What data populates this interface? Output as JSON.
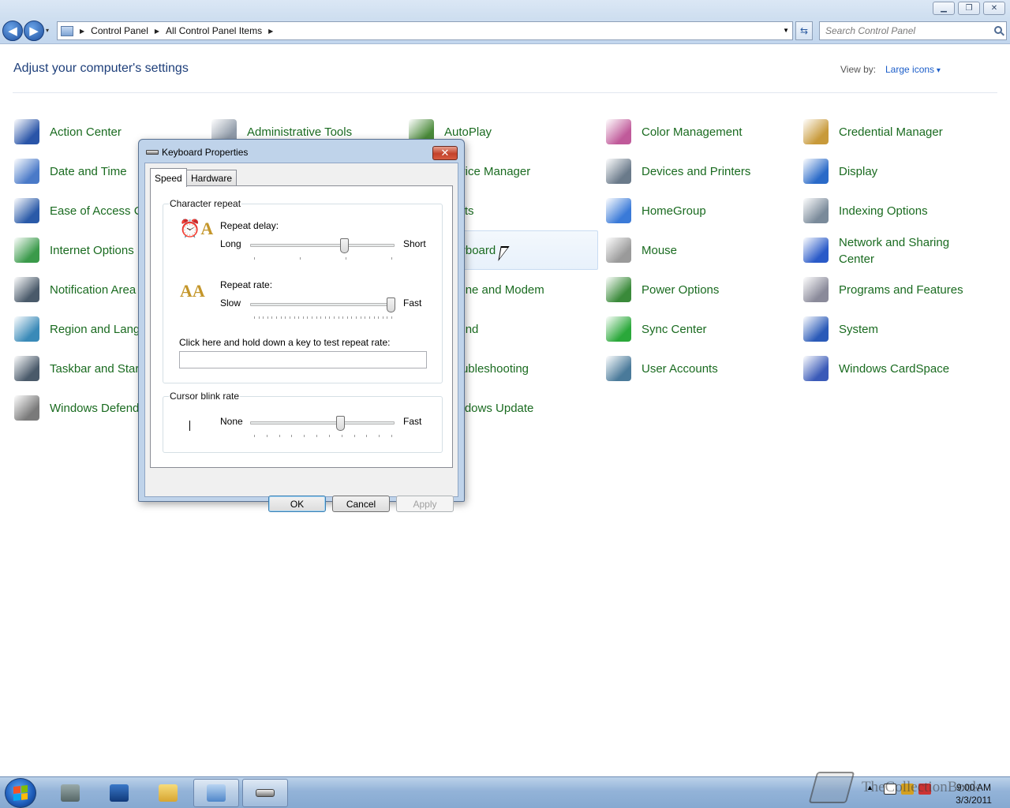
{
  "window": {
    "minimize_glyph": "▁",
    "restore_glyph": "❐",
    "close_glyph": "✕"
  },
  "nav": {
    "back_glyph": "◀",
    "forward_glyph": "▶",
    "dropdown_glyph": "▾",
    "breadcrumbs": [
      "Control Panel",
      "All Control Panel Items"
    ],
    "refresh_glyph": "⇆",
    "search_placeholder": "Search Control Panel"
  },
  "header": {
    "title": "Adjust your computer's settings",
    "view_by_label": "View by:",
    "view_by_value": "Large icons"
  },
  "items": [
    {
      "label": "Action Center",
      "icon": "flag-icon",
      "color": "#2a55a8"
    },
    {
      "label": "Administrative Tools",
      "icon": "gears-icon",
      "color": "#8f9aa8"
    },
    {
      "label": "AutoPlay",
      "icon": "autoplay-icon",
      "color": "#4a8a3a"
    },
    {
      "label": "Color Management",
      "icon": "color-management-icon",
      "color": "#c05a9a"
    },
    {
      "label": "Credential Manager",
      "icon": "vault-icon",
      "color": "#c89a3a"
    },
    {
      "label": "Date and Time",
      "icon": "calendar-clock-icon",
      "color": "#4a7ac8"
    },
    {
      "label": "Device Manager",
      "icon": "device-manager-icon",
      "color": "#6a7a8a"
    },
    {
      "label": "Devices and Printers",
      "icon": "printer-icon",
      "color": "#6a7a8a"
    },
    {
      "label": "Display",
      "icon": "monitor-icon",
      "color": "#2a6ac8"
    },
    {
      "label": "Ease of Access Center",
      "icon": "ease-of-access-icon",
      "color": "#2a5aa8"
    },
    {
      "label": "Fonts",
      "icon": "fonts-icon",
      "color": "#c8a43a"
    },
    {
      "label": "HomeGroup",
      "icon": "homegroup-icon",
      "color": "#3a7ad8"
    },
    {
      "label": "Indexing Options",
      "icon": "indexing-icon",
      "color": "#7a8a9a"
    },
    {
      "label": "Internet Options",
      "icon": "globe-icon",
      "color": "#3a9a4a"
    },
    {
      "label": "Keyboard",
      "icon": "keyboard-icon",
      "color": "#6a6a6a"
    },
    {
      "label": "Mouse",
      "icon": "mouse-icon",
      "color": "#9a9a9a"
    },
    {
      "label": "Network and Sharing Center",
      "icon": "network-icon",
      "color": "#2a5ac8"
    },
    {
      "label": "Notification Area Icons",
      "icon": "notification-icon",
      "color": "#4a5a6a"
    },
    {
      "label": "Phone and Modem",
      "icon": "phone-icon",
      "color": "#6a6a7a"
    },
    {
      "label": "Power Options",
      "icon": "battery-icon",
      "color": "#3a8a3a"
    },
    {
      "label": "Programs and Features",
      "icon": "programs-icon",
      "color": "#8a8a9a"
    },
    {
      "label": "Region and Language",
      "icon": "region-globe-icon",
      "color": "#3a8ab8"
    },
    {
      "label": "Sound",
      "icon": "speaker-icon",
      "color": "#6a7a8a"
    },
    {
      "label": "Sync Center",
      "icon": "sync-icon",
      "color": "#2aa83a"
    },
    {
      "label": "System",
      "icon": "system-icon",
      "color": "#2a5ab8"
    },
    {
      "label": "Taskbar and Start Menu",
      "icon": "taskbar-icon",
      "color": "#4a5a6a"
    },
    {
      "label": "Troubleshooting",
      "icon": "troubleshoot-icon",
      "color": "#3a6aa8"
    },
    {
      "label": "User Accounts",
      "icon": "users-icon",
      "color": "#4a7a9a"
    },
    {
      "label": "Windows CardSpace",
      "icon": "cardspace-icon",
      "color": "#3a5ab8"
    },
    {
      "label": "Windows Defender",
      "icon": "wall-icon",
      "color": "#7a7a7a"
    },
    {
      "label": "Windows Update",
      "icon": "update-icon",
      "color": "#3a7ac8"
    }
  ],
  "dialog": {
    "title": "Keyboard Properties",
    "close_glyph": "✕",
    "tabs": [
      "Speed",
      "Hardware"
    ],
    "character_repeat": {
      "legend": "Character repeat",
      "repeat_delay_label": "Repeat delay:",
      "delay_min": "Long",
      "delay_max": "Short",
      "delay_level": 0.67,
      "repeat_rate_label": "Repeat rate:",
      "rate_min": "Slow",
      "rate_max": "Fast",
      "rate_level": 1.0,
      "test_label": "Click here and hold down a key to test repeat rate:",
      "test_value": ""
    },
    "cursor_blink": {
      "legend": "Cursor blink rate",
      "min": "None",
      "max": "Fast",
      "level": 0.64
    },
    "buttons": {
      "ok": "OK",
      "cancel": "Cancel",
      "apply": "Apply"
    }
  },
  "taskbar": {
    "watermark": "TheCollectionBook",
    "time": "9:00 AM",
    "date": "3/3/2011"
  }
}
